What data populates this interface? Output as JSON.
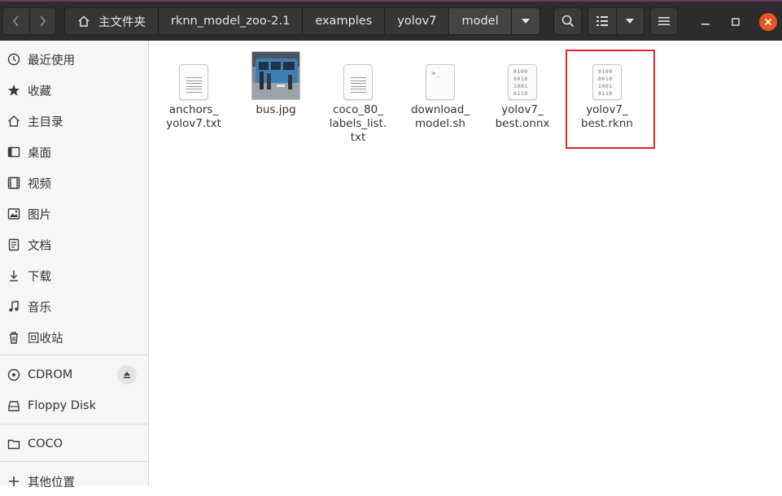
{
  "colors": {
    "header_bg": "#2c2c2c",
    "accent_close": "#e95420",
    "sidebar_bg": "#f6f6f6",
    "highlight_box": "#e0242c"
  },
  "breadcrumb": {
    "home_label": "主文件夹",
    "segments": [
      "rknn_model_zoo-2.1",
      "examples",
      "yolov7",
      "model"
    ]
  },
  "toolbar": {
    "search_icon": "search-icon",
    "view_icon": "list-view-icon",
    "menu_icon": "hamburger-menu-icon"
  },
  "sidebar": {
    "places": [
      {
        "label": "最近使用",
        "icon": "clock-icon"
      },
      {
        "label": "收藏",
        "icon": "star-icon"
      },
      {
        "label": "主目录",
        "icon": "home-icon"
      },
      {
        "label": "桌面",
        "icon": "desktop-icon"
      },
      {
        "label": "视频",
        "icon": "video-icon"
      },
      {
        "label": "图片",
        "icon": "image-icon"
      },
      {
        "label": "文档",
        "icon": "document-icon"
      },
      {
        "label": "下载",
        "icon": "download-icon"
      },
      {
        "label": "音乐",
        "icon": "music-icon"
      },
      {
        "label": "回收站",
        "icon": "trash-icon"
      }
    ],
    "devices": [
      {
        "label": "CDROM",
        "icon": "disc-icon"
      },
      {
        "label": "Floppy Disk",
        "icon": "drive-icon"
      }
    ],
    "bookmarks": [
      {
        "label": "COCO",
        "icon": "folder-icon"
      }
    ],
    "other": {
      "label": "其他位置",
      "icon": "plus-icon"
    }
  },
  "files": [
    {
      "line1": "anchors_",
      "line2": "yolov7.txt",
      "line3": "",
      "type": "text"
    },
    {
      "line1": "bus.jpg",
      "line2": "",
      "line3": "",
      "type": "image"
    },
    {
      "line1": "coco_80_",
      "line2": "labels_list.",
      "line3": "txt",
      "type": "text"
    },
    {
      "line1": "download_",
      "line2": "model.sh",
      "line3": "",
      "type": "script"
    },
    {
      "line1": "yolov7_",
      "line2": "best.onnx",
      "line3": "",
      "type": "binary"
    },
    {
      "line1": "yolov7_",
      "line2": "best.rknn",
      "line3": "",
      "type": "binary"
    }
  ],
  "binary_glyph": [
    "0100",
    "0010",
    "1001",
    "0110"
  ],
  "script_glyph": ">_"
}
